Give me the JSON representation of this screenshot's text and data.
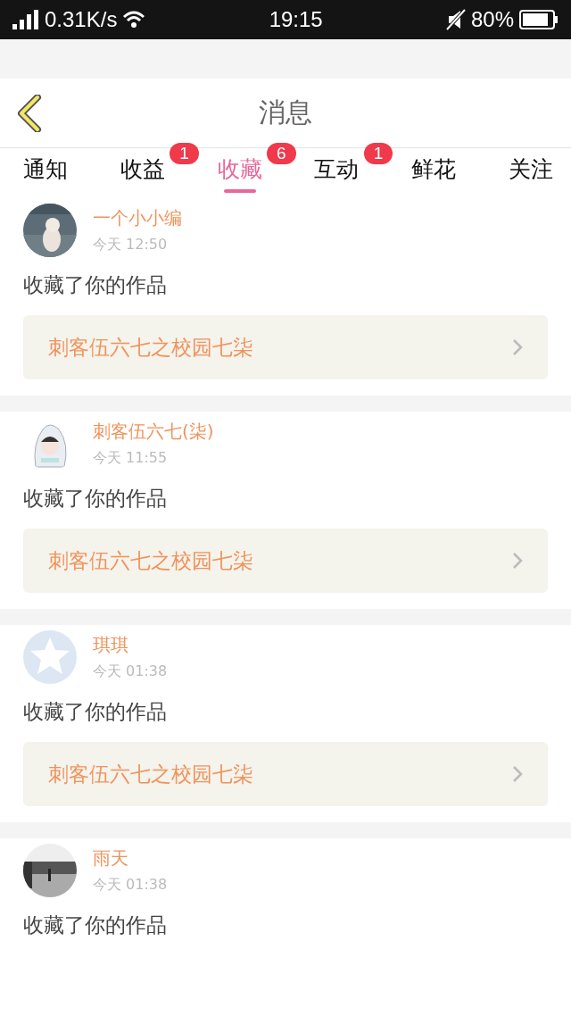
{
  "status_bar": {
    "speed": "0.31K/s",
    "time": "19:15",
    "battery": "80%"
  },
  "header": {
    "title": "消息"
  },
  "tabs": [
    {
      "label": "通知",
      "selected": false
    },
    {
      "label": "收益",
      "selected": false,
      "badge": "1"
    },
    {
      "label": "收藏",
      "selected": true,
      "badge": "6"
    },
    {
      "label": "互动",
      "selected": false,
      "badge": "1"
    },
    {
      "label": "鲜花",
      "selected": false
    },
    {
      "label": "关注",
      "selected": false
    }
  ],
  "messages": [
    {
      "name": "一个小小编",
      "time": "今天 12:50",
      "text": "收藏了你的作品",
      "work": "刺客伍六七之校园七柒"
    },
    {
      "avatar": {
        "kind": "cartoon"
      },
      "name": "刺客伍六七(柒)",
      "time": "今天 11:55",
      "text": "收藏了你的作品",
      "work": "刺客伍六七之校园七柒"
    },
    {
      "avatar": {
        "kind": "default"
      },
      "name": "琪琪",
      "time": "今天 01:38",
      "text": "收藏了你的作品",
      "work": "刺客伍六七之校园七柒"
    },
    {
      "name": "雨天",
      "time": "今天 01:38",
      "text": "收藏了你的作品"
    }
  ]
}
